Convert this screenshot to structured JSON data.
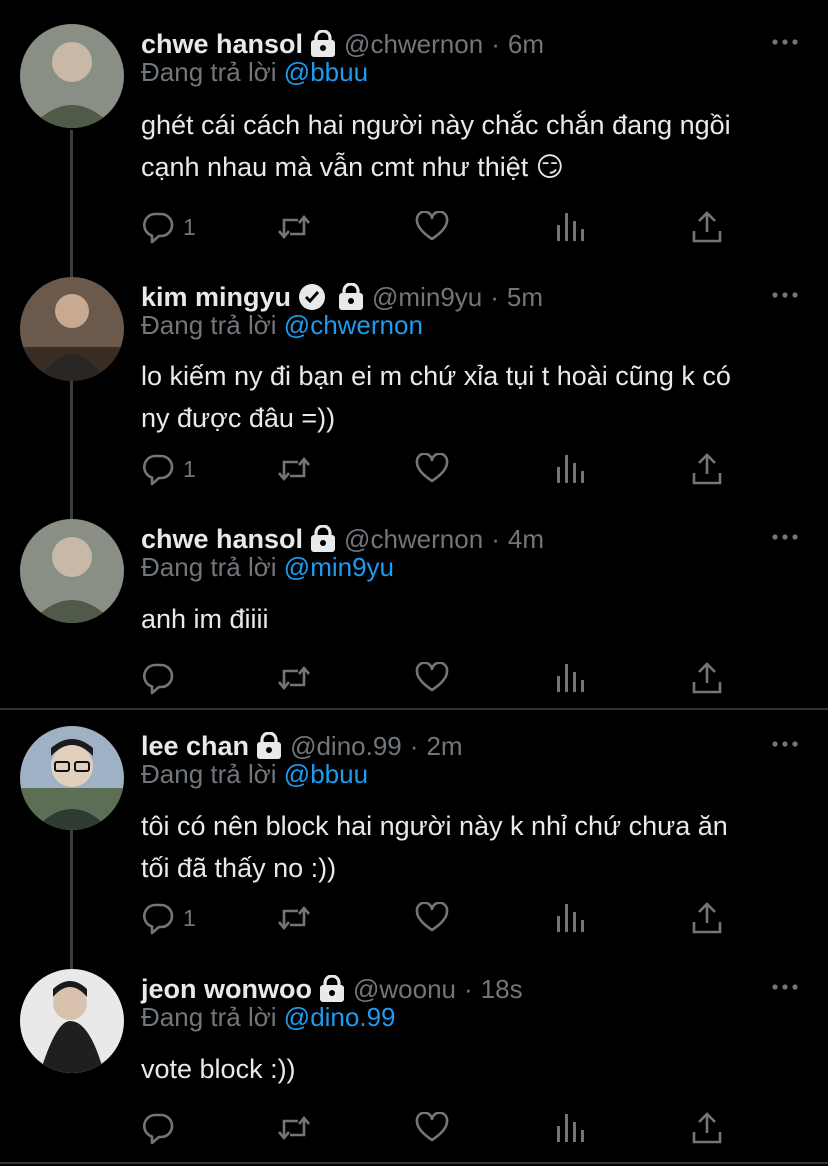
{
  "tweets": [
    {
      "name": "chwe hansol",
      "verified": false,
      "handle": "@chwernon",
      "time": "6m",
      "replying_label": "Đang trả lời",
      "replying_to": "@bbuu",
      "text_lines": [
        "ghét cái cách hai người này chắc chắn đang ngồi",
        "cạnh nhau mà vẫn cmt như thiệt 😏"
      ],
      "reply_count": "1",
      "avatar_colors": [
        "#8a8f86",
        "#4f5a48"
      ]
    },
    {
      "name": "kim mingyu",
      "verified": true,
      "handle": "@min9yu",
      "time": "5m",
      "replying_label": "Đang trả lời",
      "replying_to": "@chwernon",
      "text_lines": [
        "lo kiếm ny đi bạn ei m chứ xỉa tụi t hoài cũng k có",
        "ny được đâu =))"
      ],
      "reply_count": "1",
      "avatar_colors": [
        "#6b5a4c",
        "#2a2623"
      ]
    },
    {
      "name": "chwe hansol",
      "verified": false,
      "handle": "@chwernon",
      "time": "4m",
      "replying_label": "Đang trả lời",
      "replying_to": "@min9yu",
      "text_lines": [
        "anh im điiii"
      ],
      "reply_count": "",
      "avatar_colors": [
        "#8a8f86",
        "#4f5a48"
      ]
    },
    {
      "name": "lee chan",
      "verified": false,
      "handle": "@dino.99",
      "time": "2m",
      "replying_label": "Đang trả lời",
      "replying_to": "@bbuu",
      "text_lines": [
        "tôi có nên block hai người này k nhỉ chứ chưa ăn",
        "tối đã thấy no :))"
      ],
      "reply_count": "1",
      "avatar_colors": [
        "#9fb1c4",
        "#5d6e57"
      ]
    },
    {
      "name": "jeon wonwoo",
      "verified": false,
      "handle": "@woonu",
      "time": "18s",
      "replying_label": "Đang trả lời",
      "replying_to": "@dino.99",
      "text_lines": [
        "vote block :))"
      ],
      "reply_count": "",
      "avatar_colors": [
        "#e9e9e9",
        "#1f1f1f"
      ]
    }
  ],
  "separator": "·",
  "icons": [
    "lock-icon",
    "verified-badge-icon",
    "more-icon",
    "reply-icon",
    "retweet-icon",
    "like-icon",
    "analytics-icon",
    "share-icon"
  ],
  "colors": {
    "background": "#000000",
    "text": "#e7e9ea",
    "muted": "#71767b",
    "link": "#1d9bf0",
    "divider": "#2f3336"
  }
}
